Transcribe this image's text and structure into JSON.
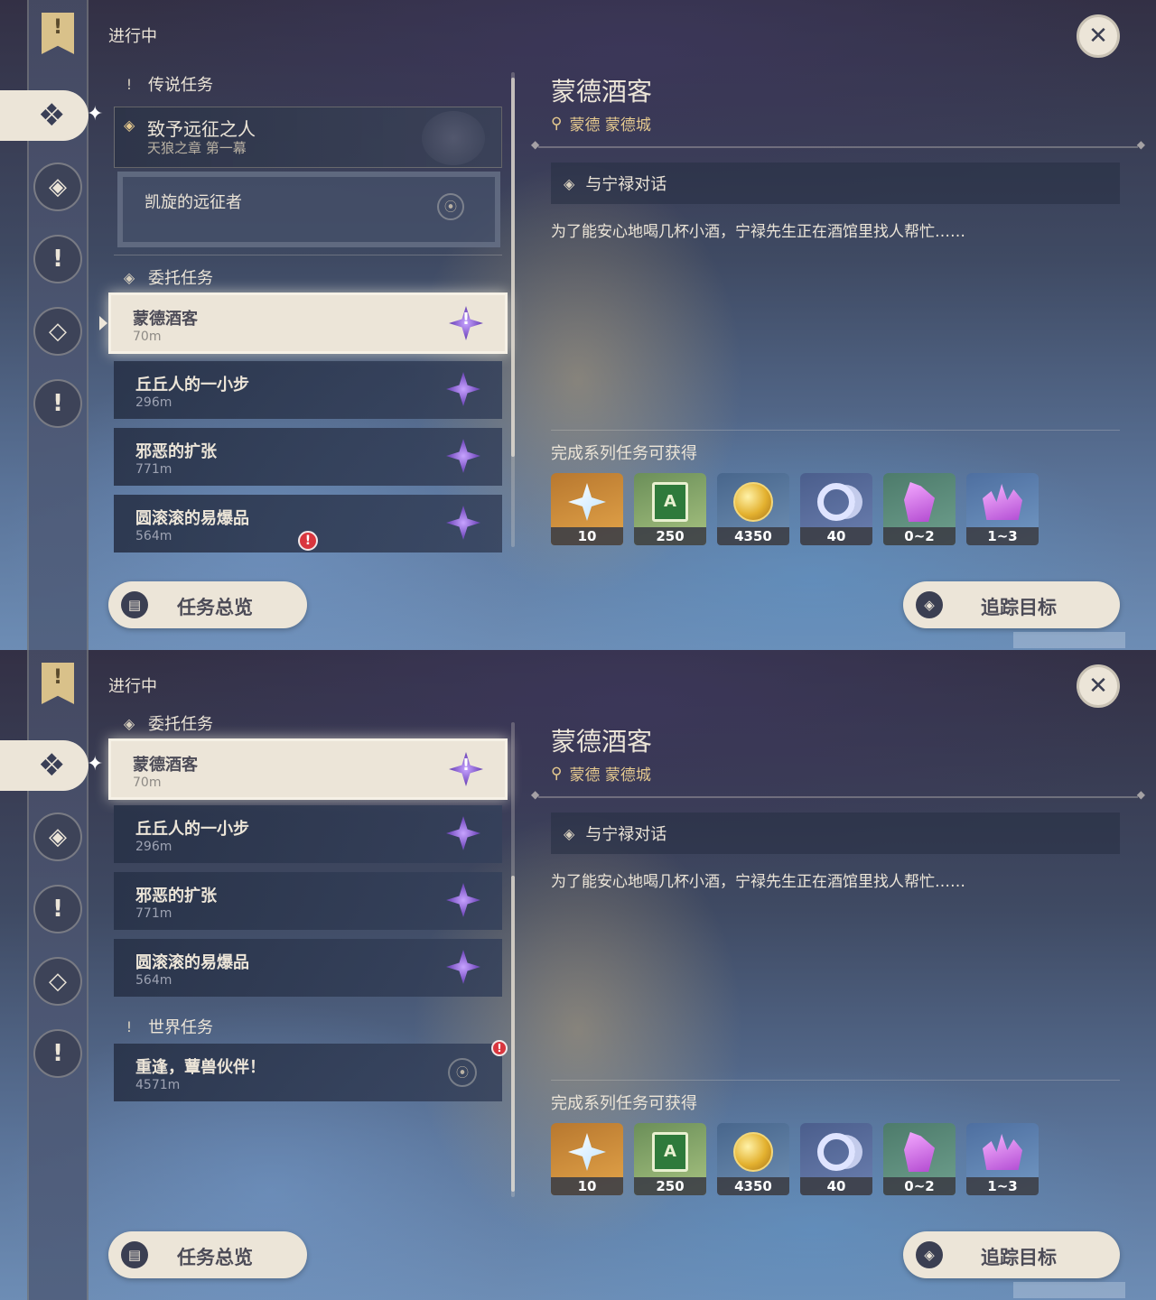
{
  "header": {
    "in_progress": "进行中"
  },
  "sections": {
    "archon": "传说任务",
    "commission": "委托任务",
    "world": "世界任务"
  },
  "archon_quest": {
    "title": "致予远征之人",
    "subtitle": "天狼之章 第一幕",
    "sub_quest": "凯旋的远征者"
  },
  "commissions": [
    {
      "name": "蒙德酒客",
      "distance": "70m"
    },
    {
      "name": "丘丘人的一小步",
      "distance": "296m"
    },
    {
      "name": "邪恶的扩张",
      "distance": "771m"
    },
    {
      "name": "圆滚滚的易爆品",
      "distance": "564m"
    }
  ],
  "world_quest": {
    "name": "重逢，蕈兽伙伴！",
    "distance": "4571m"
  },
  "detail": {
    "title": "蒙德酒客",
    "location": "蒙德 蒙德城",
    "step": "与宁禄对话",
    "description": "为了能安心地喝几杯小酒，宁禄先生正在酒馆里找人帮忙……",
    "rewards_title": "完成系列任务可获得",
    "rewards": [
      {
        "icon": "primogem-icon",
        "count": "10"
      },
      {
        "icon": "adventure-exp-book-icon",
        "count": "250"
      },
      {
        "icon": "mora-icon",
        "count": "4350"
      },
      {
        "icon": "companionship-exp-icon",
        "count": "40"
      },
      {
        "icon": "crystal-chunk-icon",
        "count": "0~2"
      },
      {
        "icon": "crystal-cluster-icon",
        "count": "1~3"
      }
    ]
  },
  "buttons": {
    "overview": "任务总览",
    "track": "追踪目标"
  },
  "icons": {
    "sidebar": [
      "quest-banner-icon",
      "all-quests-icon",
      "archon-quest-icon",
      "story-quest-icon",
      "commission-icon",
      "world-quest-icon"
    ],
    "close": "close-icon"
  },
  "colors": {
    "panel_cream": "#ece5d8",
    "location_gold": "#e5c98f",
    "commission_purple": "#7a52c4",
    "alert_red": "#d9363e"
  }
}
